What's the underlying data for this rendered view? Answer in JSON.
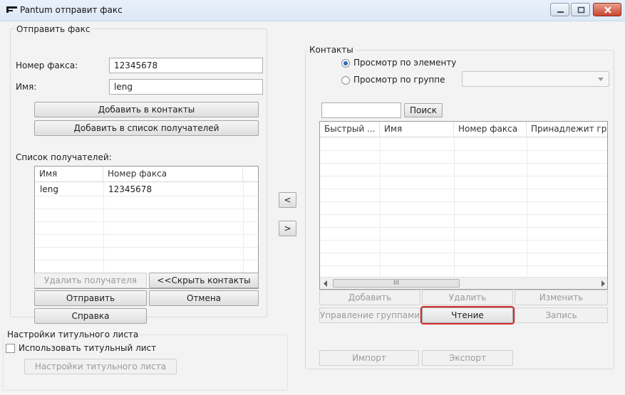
{
  "window": {
    "title": "Pantum отправит факс"
  },
  "send_fax": {
    "group_title": "Отправить факс",
    "fax_number_label": "Номер факса:",
    "fax_number_value": "12345678",
    "name_label": "Имя:",
    "name_value": "leng",
    "add_to_contacts": "Добавить в контакты",
    "add_to_recipients": "Добавить в список получателей",
    "recipients_label": "Список получателей:",
    "recipients_columns": [
      "Имя",
      "Номер факса"
    ],
    "recipients_rows": [
      {
        "name": "leng",
        "fax": "12345678"
      }
    ],
    "remove_recipient": "Удалить получателя",
    "hide_contacts": "<<Скрыть контакты",
    "send": "Отправить",
    "cancel": "Отмена",
    "help": "Справка"
  },
  "transfer": {
    "move_left": "<",
    "move_right": ">"
  },
  "cover": {
    "group_title": "Настройки титульного листа",
    "use_cover": "Использовать титульный лист",
    "use_cover_checked": false,
    "cover_settings": "Настройки титульного листа"
  },
  "contacts": {
    "group_title": "Контакты",
    "view_by_item": "Просмотр по элементу",
    "view_by_group": "Просмотр по группе",
    "selected_view": "item",
    "group_select_value": "",
    "search_value": "",
    "search_button": "Поиск",
    "columns": [
      "Быстрый ...",
      "Имя",
      "Номер факса",
      "Принадлежит гру"
    ],
    "rows": [],
    "scroll_center": "III",
    "add": "Добавить",
    "delete": "Удалить",
    "edit": "Изменить",
    "manage_groups": "Управление группами",
    "read": "Чтение",
    "write": "Запись",
    "import": "Импорт",
    "export": "Экспорт"
  },
  "colors": {
    "highlight": "#d42f2f",
    "window_bg": "#f3f3f3",
    "close_button": "#c9452f"
  }
}
